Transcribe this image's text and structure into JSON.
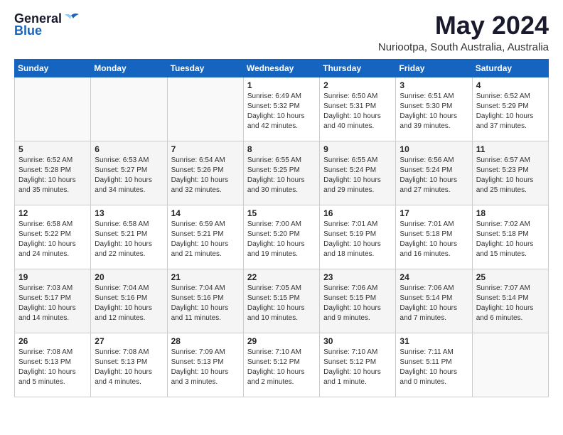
{
  "header": {
    "logo_general": "General",
    "logo_blue": "Blue",
    "month_year": "May 2024",
    "location": "Nuriootpa, South Australia, Australia"
  },
  "calendar": {
    "days_of_week": [
      "Sunday",
      "Monday",
      "Tuesday",
      "Wednesday",
      "Thursday",
      "Friday",
      "Saturday"
    ],
    "weeks": [
      [
        {
          "day": "",
          "content": ""
        },
        {
          "day": "",
          "content": ""
        },
        {
          "day": "",
          "content": ""
        },
        {
          "day": "1",
          "content": "Sunrise: 6:49 AM\nSunset: 5:32 PM\nDaylight: 10 hours\nand 42 minutes."
        },
        {
          "day": "2",
          "content": "Sunrise: 6:50 AM\nSunset: 5:31 PM\nDaylight: 10 hours\nand 40 minutes."
        },
        {
          "day": "3",
          "content": "Sunrise: 6:51 AM\nSunset: 5:30 PM\nDaylight: 10 hours\nand 39 minutes."
        },
        {
          "day": "4",
          "content": "Sunrise: 6:52 AM\nSunset: 5:29 PM\nDaylight: 10 hours\nand 37 minutes."
        }
      ],
      [
        {
          "day": "5",
          "content": "Sunrise: 6:52 AM\nSunset: 5:28 PM\nDaylight: 10 hours\nand 35 minutes."
        },
        {
          "day": "6",
          "content": "Sunrise: 6:53 AM\nSunset: 5:27 PM\nDaylight: 10 hours\nand 34 minutes."
        },
        {
          "day": "7",
          "content": "Sunrise: 6:54 AM\nSunset: 5:26 PM\nDaylight: 10 hours\nand 32 minutes."
        },
        {
          "day": "8",
          "content": "Sunrise: 6:55 AM\nSunset: 5:25 PM\nDaylight: 10 hours\nand 30 minutes."
        },
        {
          "day": "9",
          "content": "Sunrise: 6:55 AM\nSunset: 5:24 PM\nDaylight: 10 hours\nand 29 minutes."
        },
        {
          "day": "10",
          "content": "Sunrise: 6:56 AM\nSunset: 5:24 PM\nDaylight: 10 hours\nand 27 minutes."
        },
        {
          "day": "11",
          "content": "Sunrise: 6:57 AM\nSunset: 5:23 PM\nDaylight: 10 hours\nand 25 minutes."
        }
      ],
      [
        {
          "day": "12",
          "content": "Sunrise: 6:58 AM\nSunset: 5:22 PM\nDaylight: 10 hours\nand 24 minutes."
        },
        {
          "day": "13",
          "content": "Sunrise: 6:58 AM\nSunset: 5:21 PM\nDaylight: 10 hours\nand 22 minutes."
        },
        {
          "day": "14",
          "content": "Sunrise: 6:59 AM\nSunset: 5:21 PM\nDaylight: 10 hours\nand 21 minutes."
        },
        {
          "day": "15",
          "content": "Sunrise: 7:00 AM\nSunset: 5:20 PM\nDaylight: 10 hours\nand 19 minutes."
        },
        {
          "day": "16",
          "content": "Sunrise: 7:01 AM\nSunset: 5:19 PM\nDaylight: 10 hours\nand 18 minutes."
        },
        {
          "day": "17",
          "content": "Sunrise: 7:01 AM\nSunset: 5:18 PM\nDaylight: 10 hours\nand 16 minutes."
        },
        {
          "day": "18",
          "content": "Sunrise: 7:02 AM\nSunset: 5:18 PM\nDaylight: 10 hours\nand 15 minutes."
        }
      ],
      [
        {
          "day": "19",
          "content": "Sunrise: 7:03 AM\nSunset: 5:17 PM\nDaylight: 10 hours\nand 14 minutes."
        },
        {
          "day": "20",
          "content": "Sunrise: 7:04 AM\nSunset: 5:16 PM\nDaylight: 10 hours\nand 12 minutes."
        },
        {
          "day": "21",
          "content": "Sunrise: 7:04 AM\nSunset: 5:16 PM\nDaylight: 10 hours\nand 11 minutes."
        },
        {
          "day": "22",
          "content": "Sunrise: 7:05 AM\nSunset: 5:15 PM\nDaylight: 10 hours\nand 10 minutes."
        },
        {
          "day": "23",
          "content": "Sunrise: 7:06 AM\nSunset: 5:15 PM\nDaylight: 10 hours\nand 9 minutes."
        },
        {
          "day": "24",
          "content": "Sunrise: 7:06 AM\nSunset: 5:14 PM\nDaylight: 10 hours\nand 7 minutes."
        },
        {
          "day": "25",
          "content": "Sunrise: 7:07 AM\nSunset: 5:14 PM\nDaylight: 10 hours\nand 6 minutes."
        }
      ],
      [
        {
          "day": "26",
          "content": "Sunrise: 7:08 AM\nSunset: 5:13 PM\nDaylight: 10 hours\nand 5 minutes."
        },
        {
          "day": "27",
          "content": "Sunrise: 7:08 AM\nSunset: 5:13 PM\nDaylight: 10 hours\nand 4 minutes."
        },
        {
          "day": "28",
          "content": "Sunrise: 7:09 AM\nSunset: 5:13 PM\nDaylight: 10 hours\nand 3 minutes."
        },
        {
          "day": "29",
          "content": "Sunrise: 7:10 AM\nSunset: 5:12 PM\nDaylight: 10 hours\nand 2 minutes."
        },
        {
          "day": "30",
          "content": "Sunrise: 7:10 AM\nSunset: 5:12 PM\nDaylight: 10 hours\nand 1 minute."
        },
        {
          "day": "31",
          "content": "Sunrise: 7:11 AM\nSunset: 5:11 PM\nDaylight: 10 hours\nand 0 minutes."
        },
        {
          "day": "",
          "content": ""
        }
      ]
    ]
  }
}
